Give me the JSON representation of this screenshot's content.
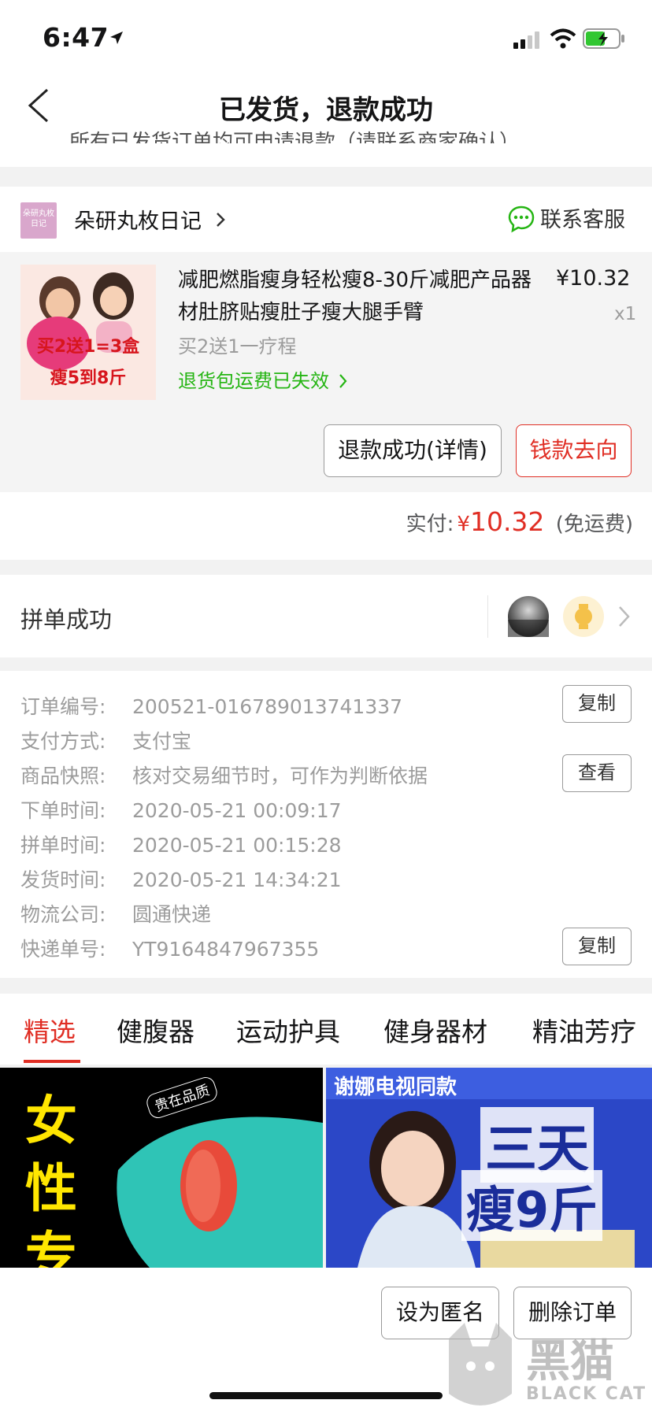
{
  "status_bar": {
    "time": "6:47"
  },
  "nav": {
    "title": "已发货，退款成功"
  },
  "clipped_notice": "所有已发货订单均可申请退款（请联系商家确认）",
  "shop": {
    "name": "朵研丸枚日记",
    "logo_text": "朵研丸枚日记",
    "contact_label": "联系客服"
  },
  "goods": {
    "title": "减肥燃脂瘦身轻松瘦8-30斤减肥产品器材肚脐贴瘦肚子瘦大腿手臂",
    "price": "¥10.32",
    "qty": "x1",
    "spec": "买2送1一疗程",
    "return_shipping": "退货包运费已失效",
    "img_text_1": "买2送1=3盒",
    "img_text_2": "瘦5到8斤"
  },
  "actions": {
    "refund_detail": "退款成功(详情)",
    "money_flow": "钱款去向"
  },
  "payment": {
    "label": "实付:",
    "currency": "¥",
    "amount": "10.32",
    "note": "(免运费)"
  },
  "group": {
    "label": "拼单成功"
  },
  "order_info": {
    "rows": [
      {
        "key": "订单编号:",
        "value": "200521-016789013741337"
      },
      {
        "key": "支付方式:",
        "value": "支付宝"
      },
      {
        "key": "商品快照:",
        "value": "核对交易细节时，可作为判断依据"
      },
      {
        "key": "下单时间:",
        "value": "2020-05-21 00:09:17"
      },
      {
        "key": "拼单时间:",
        "value": "2020-05-21 00:15:28"
      },
      {
        "key": "发货时间:",
        "value": "2020-05-21 14:34:21"
      },
      {
        "key": "物流公司:",
        "value": "圆通快递"
      },
      {
        "key": "快递单号:",
        "value": "YT9164847967355"
      }
    ],
    "copy_label": "复制",
    "view_label": "查看"
  },
  "tabs": [
    "精选",
    "健腹器",
    "运动护具",
    "健身器材",
    "精油芳疗"
  ],
  "ads": {
    "left": {
      "line1": "女",
      "line2": "性",
      "line3": "专",
      "badge": "贵在品质"
    },
    "right": {
      "banner": "谢娜电视同款",
      "line1": "三天",
      "line2": "瘦9斤"
    }
  },
  "bottom_actions": {
    "anonymous": "设为匿名",
    "delete": "删除订单"
  },
  "watermark": {
    "cn": "黑猫",
    "en": "BLACK CAT"
  },
  "colors": {
    "accent": "#e02e24",
    "green": "#25b513",
    "gray_text": "#9c9c9c"
  }
}
